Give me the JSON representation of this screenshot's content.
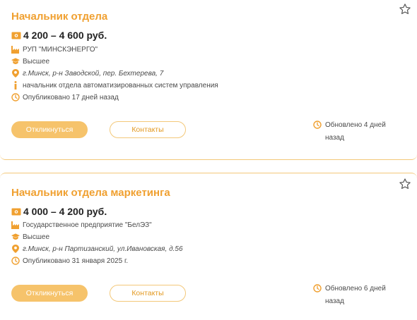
{
  "colors": {
    "accent": "#f0a030",
    "button_fill": "#f6c36b",
    "border": "#f3c879",
    "text": "#4a4a4a"
  },
  "vacancies": [
    {
      "title": "Начальник отдела",
      "salary": "4 200 – 4 600 руб.",
      "company": "РУП \"МИНСКЭНЕРГО\"",
      "education": "Высшее",
      "address": "г.Минск, р-н Заводской, пер. Бехтерева, 7",
      "description": "начальник отдела автоматизированных систем управления",
      "published": "Опубликовано 17 дней назад",
      "apply_label": "Откликнуться",
      "contacts_label": "Контакты",
      "updated_line1": "Обновлено 4 дней",
      "updated_line2": "назад"
    },
    {
      "title": "Начальник отдела маркетинга",
      "salary": "4 000 – 4 200 руб.",
      "company": "Государственное предприятие \"БелЭЗ\"",
      "education": "Высшее",
      "address": "г.Минск, р-н Партизанский, ул.Ивановская, д.56",
      "published": "Опубликовано 31 января 2025 г.",
      "apply_label": "Откликнуться",
      "contacts_label": "Контакты",
      "updated_line1": "Обновлено 6 дней",
      "updated_line2": "назад"
    }
  ],
  "icons": {
    "favorite": "star-outline-icon",
    "salary": "money-icon",
    "company": "factory-icon",
    "education": "graduation-cap-icon",
    "address": "location-pin-icon",
    "description": "info-icon",
    "published": "clock-icon",
    "updated": "clock-icon"
  }
}
